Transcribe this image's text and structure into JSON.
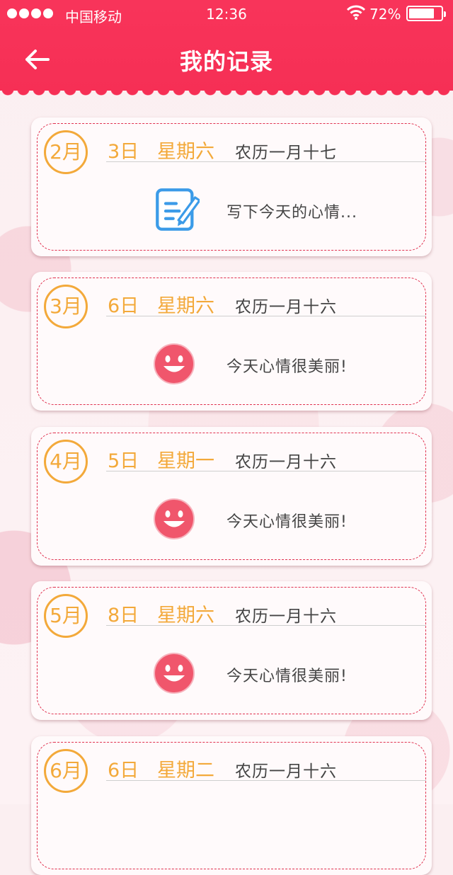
{
  "status": {
    "carrier": "中国移动",
    "time": "12:36",
    "battery": "72%"
  },
  "header": {
    "title": "我的记录"
  },
  "records": [
    {
      "month": "2月",
      "day": "3日",
      "weekday": "星期六",
      "lunar": "农历一月十七",
      "note": "写下今天的心情...",
      "icon": "write-note-icon"
    },
    {
      "month": "3月",
      "day": "6日",
      "weekday": "星期六",
      "lunar": "农历一月十六",
      "note": "今天心情很美丽!",
      "icon": "smiley-icon"
    },
    {
      "month": "4月",
      "day": "5日",
      "weekday": "星期一",
      "lunar": "农历一月十六",
      "note": "今天心情很美丽!",
      "icon": "smiley-icon"
    },
    {
      "month": "5月",
      "day": "8日",
      "weekday": "星期六",
      "lunar": "农历一月十六",
      "note": "今天心情很美丽!",
      "icon": "smiley-icon"
    },
    {
      "month": "6月",
      "day": "6日",
      "weekday": "星期二",
      "lunar": "农历一月十六",
      "note": "",
      "icon": ""
    }
  ],
  "colors": {
    "header": "#f62f55",
    "accent": "#f3a93a",
    "dash": "#e0314f",
    "smiley": "#f0566c",
    "note_icon": "#3b9be8"
  }
}
